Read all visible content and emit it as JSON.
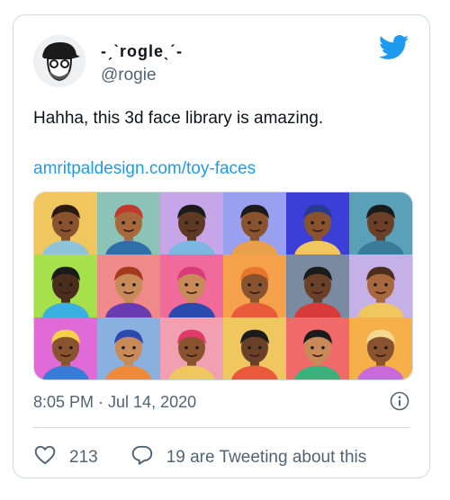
{
  "author": {
    "display_name": "-ˏˋrogleˎˊ-",
    "handle": "@rogie"
  },
  "tweet": {
    "text": "Hahha, this 3d face library is amazing.",
    "link_text": "amritpaldesign.com/toy-faces",
    "timestamp": "8:05 PM · Jul 14, 2020"
  },
  "engagement": {
    "likes": "213",
    "conversation_text": "19 are Tweeting about this"
  },
  "icons": {
    "brand": "twitter-bird-icon",
    "info": "info-icon",
    "like": "heart-icon",
    "reply": "speech-bubble-icon"
  },
  "colors": {
    "link": "#1d9bf0",
    "twitter_blue": "#1d9bf0",
    "secondary_text": "#536471",
    "border": "#cfd9de"
  },
  "media": {
    "tiles": [
      {
        "bg": "#f0c75e",
        "skin": "#8a5330",
        "hair": "#2b1a12",
        "shirt": "#8ec3d8"
      },
      {
        "bg": "#8bc4b6",
        "skin": "#a8683e",
        "hair": "#c0392b",
        "shirt": "#2f6ea8"
      },
      {
        "bg": "#c6a6e8",
        "skin": "#5e3a24",
        "hair": "#1b1b1b",
        "shirt": "#7bb7e0"
      },
      {
        "bg": "#9aa0f0",
        "skin": "#8a5330",
        "hair": "#1b1b1b",
        "shirt": "#e9a04a"
      },
      {
        "bg": "#3b3fd8",
        "skin": "#8a5330",
        "hair": "#2a3a8f",
        "shirt": "#f0c75e"
      },
      {
        "bg": "#5aa0b8",
        "skin": "#6b4028",
        "hair": "#1b1b1b",
        "shirt": "#3a7a9a"
      },
      {
        "bg": "#a6e04a",
        "skin": "#4a2d1c",
        "hair": "#1b1b1b",
        "shirt": "#3ab0e0"
      },
      {
        "bg": "#f08a8a",
        "skin": "#c98a5a",
        "hair": "#a33a1c",
        "shirt": "#6a3ab0"
      },
      {
        "bg": "#f06a9a",
        "skin": "#c98a5a",
        "hair": "#d83a7a",
        "shirt": "#2a4ab0"
      },
      {
        "bg": "#f5a04a",
        "skin": "#8a5330",
        "hair": "#e8762c",
        "shirt": "#e85a3a"
      },
      {
        "bg": "#7a8aa0",
        "skin": "#6b4028",
        "hair": "#1b1b1b",
        "shirt": "#d83a3a"
      },
      {
        "bg": "#c6b0e8",
        "skin": "#a8683e",
        "hair": "#4a2d1c",
        "shirt": "#f0c75e"
      },
      {
        "bg": "#e06ad8",
        "skin": "#8a5330",
        "hair": "#f5d04a",
        "shirt": "#3a7ad8"
      },
      {
        "bg": "#8ab0e0",
        "skin": "#c98a5a",
        "hair": "#2a4ab0",
        "shirt": "#f08a3a"
      },
      {
        "bg": "#f0a0b0",
        "skin": "#8a5330",
        "hair": "#e03a6a",
        "shirt": "#f0c75e"
      },
      {
        "bg": "#f0c75e",
        "skin": "#6b4028",
        "hair": "#1b1b1b",
        "shirt": "#e85a3a"
      },
      {
        "bg": "#f06a6a",
        "skin": "#c98a5a",
        "hair": "#1b1b1b",
        "shirt": "#3ab07a"
      },
      {
        "bg": "#f5b04a",
        "skin": "#8a5330",
        "hair": "#f5d890",
        "shirt": "#c96ad8"
      }
    ]
  }
}
